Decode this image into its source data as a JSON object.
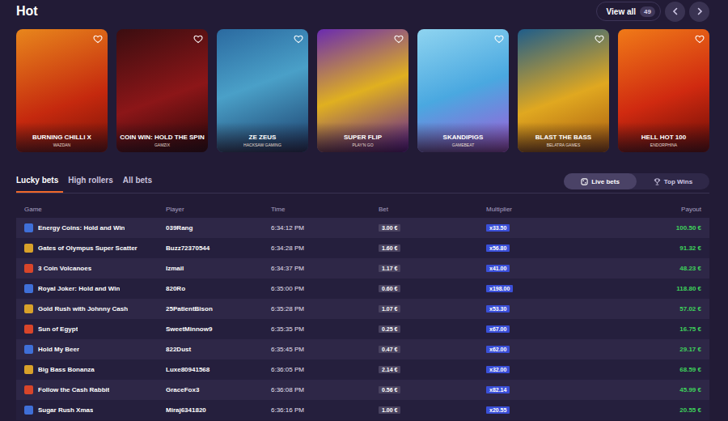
{
  "section": {
    "title": "Hot",
    "view_all": "View all",
    "count": "49"
  },
  "games": [
    {
      "name": "BURNING CHILLI X",
      "provider": "WAZDAN",
      "favorite": false
    },
    {
      "name": "COIN WIN: HOLD THE SPIN",
      "provider": "GAMZIX",
      "favorite": false
    },
    {
      "name": "ZE ZEUS",
      "provider": "HACKSAW GAMING",
      "favorite": false
    },
    {
      "name": "SUPER FLIP",
      "provider": "PLAY'N GO",
      "favorite": false
    },
    {
      "name": "SKANDIPIGS",
      "provider": "GAMEBEAT",
      "favorite": false
    },
    {
      "name": "BLAST THE BASS",
      "provider": "BELATRA GAMES",
      "favorite": false
    },
    {
      "name": "HELL HOT 100",
      "provider": "ENDORPHINA",
      "favorite": false
    }
  ],
  "bet_tabs": [
    {
      "label": "Lucky bets",
      "selected": true
    },
    {
      "label": "High rollers",
      "selected": false
    },
    {
      "label": "All bets",
      "selected": false
    }
  ],
  "feed_toggle": [
    {
      "label": "Live bets",
      "selected": true
    },
    {
      "label": "Top Wins",
      "selected": false
    }
  ],
  "table": {
    "columns": [
      "Game",
      "Player",
      "Time",
      "Bet",
      "Multiplier",
      "Payout"
    ],
    "rows": [
      {
        "game": "Energy Coins: Hold and Win",
        "player": "039Rang",
        "time": "6:34:12 PM",
        "bet": "3.00 €",
        "multiplier": "x33.50",
        "payout": "100.50 €"
      },
      {
        "game": "Gates of Olympus Super Scatter",
        "player": "Buzz72370544",
        "time": "6:34:28 PM",
        "bet": "1.60 €",
        "multiplier": "x56.80",
        "payout": "91.32 €"
      },
      {
        "game": "3 Coin Volcanoes",
        "player": "Izmail",
        "time": "6:34:37 PM",
        "bet": "1.17 €",
        "multiplier": "x41.00",
        "payout": "48.23 €"
      },
      {
        "game": "Royal Joker: Hold and Win",
        "player": "820Ro",
        "time": "6:35:00 PM",
        "bet": "0.60 €",
        "multiplier": "x198.00",
        "payout": "118.80 €"
      },
      {
        "game": "Gold Rush with Johnny Cash",
        "player": "25PatientBison",
        "time": "6:35:28 PM",
        "bet": "1.07 €",
        "multiplier": "x53.30",
        "payout": "57.02 €"
      },
      {
        "game": "Sun of Egypt",
        "player": "SweetMinnow9",
        "time": "6:35:35 PM",
        "bet": "0.25 €",
        "multiplier": "x67.00",
        "payout": "16.75 €"
      },
      {
        "game": "Hold My Beer",
        "player": "822Dust",
        "time": "6:35:45 PM",
        "bet": "0.47 €",
        "multiplier": "x62.00",
        "payout": "29.17 €"
      },
      {
        "game": "Big Bass Bonanza",
        "player": "Luxe80941568",
        "time": "6:36:05 PM",
        "bet": "2.14 €",
        "multiplier": "x32.00",
        "payout": "68.59 €"
      },
      {
        "game": "Follow the Cash Rabbit",
        "player": "GraceFox3",
        "time": "6:36:08 PM",
        "bet": "0.56 €",
        "multiplier": "x82.14",
        "payout": "45.99 €"
      },
      {
        "game": "Sugar Rush Xmas",
        "player": "Miraj6341820",
        "time": "6:36:16 PM",
        "bet": "1.00 €",
        "multiplier": "x20.55",
        "payout": "20.55 €"
      }
    ]
  }
}
